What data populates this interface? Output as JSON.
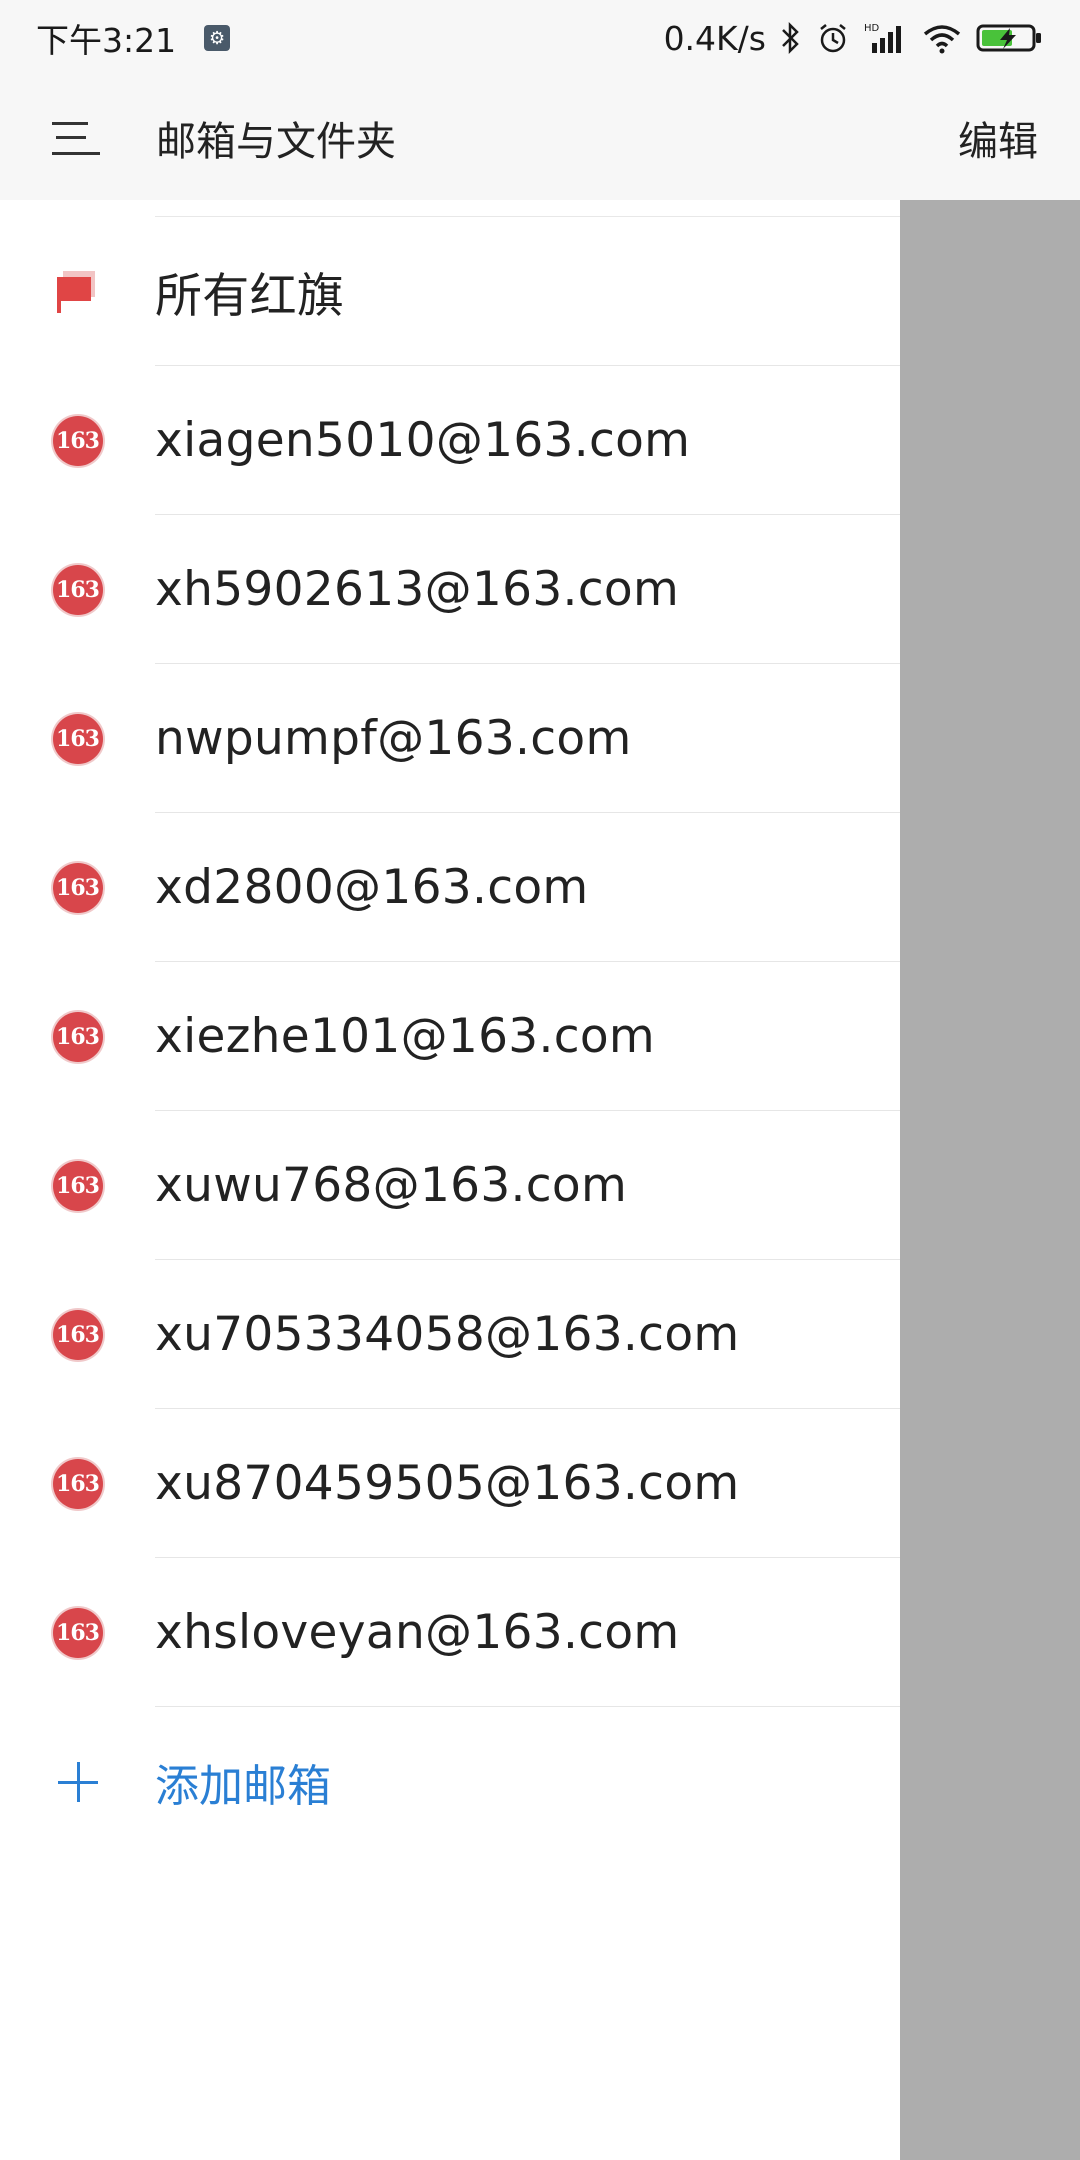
{
  "status_bar": {
    "time": "下午3:21",
    "network_speed": "0.4K/s",
    "icons": [
      "bluetooth-icon",
      "alarm-icon",
      "hd-signal-icon",
      "wifi-icon",
      "battery-charging-icon"
    ]
  },
  "header": {
    "title": "邮箱与文件夹",
    "edit_label": "编辑"
  },
  "list": {
    "flag_item": {
      "label": "所有红旗",
      "icon": "red-flag-icon"
    },
    "accounts": [
      "xiagen5010@163.com",
      "xh5902613@163.com",
      "nwpumpf@163.com",
      "xd2800@163.com",
      "xiezhe101@163.com",
      "xuwu768@163.com",
      "xu705334058@163.com",
      "xu870459505@163.com",
      "xhsloveyan@163.com"
    ],
    "account_badge_text": "163",
    "add_label": "添加邮箱"
  },
  "colors": {
    "accent_blue": "#2a7fd4",
    "badge_red": "#d8464b",
    "scrim_gray": "#adadad",
    "header_bg": "#f7f7f7"
  }
}
